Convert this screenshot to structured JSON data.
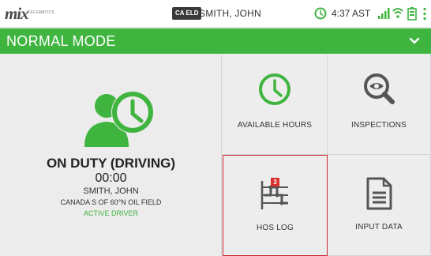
{
  "colors": {
    "accent_green": "#3fb43f",
    "selected_border": "#c9252f",
    "badge_red": "#d93030",
    "icon_gray": "#555555"
  },
  "statusbar": {
    "logo": "mix",
    "logo_sub": "TELEMATICS",
    "eld_badge": "CA ELD",
    "driver_name": "SMITH, JOHN",
    "time": "4:37 AST",
    "icons": [
      "clock-icon",
      "signal-icon",
      "wifi-icon",
      "battery-icon",
      "overflow-menu-icon"
    ]
  },
  "mode": {
    "title": "NORMAL MODE",
    "chevron_icon": "chevron-down-icon"
  },
  "status_panel": {
    "icon": "driver-clock-icon",
    "duty_status": "ON DUTY (DRIVING)",
    "duty_time": "00:00",
    "driver": "SMITH, JOHN",
    "ruleset": "CANADA S OF 60°N OIL FIELD",
    "role": "ACTIVE DRIVER"
  },
  "tiles": [
    {
      "label": "AVAILABLE HOURS",
      "icon": "clock-icon"
    },
    {
      "label": "INSPECTIONS",
      "icon": "eye-magnifier-icon"
    },
    {
      "label": "HOS LOG",
      "icon": "log-chart-icon",
      "badge": "3",
      "selected": true
    },
    {
      "label": "INPUT DATA",
      "icon": "document-icon"
    }
  ]
}
